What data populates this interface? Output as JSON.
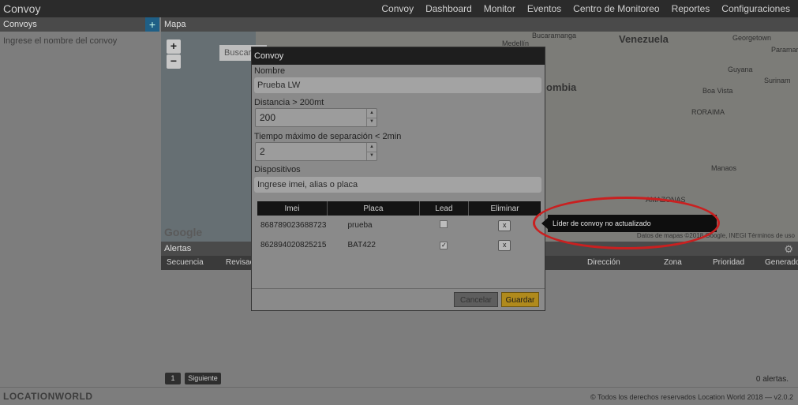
{
  "app": {
    "title": "Convoy"
  },
  "nav": [
    "Convoy",
    "Dashboard",
    "Monitor",
    "Eventos",
    "Centro de Monitoreo",
    "Reportes",
    "Configuraciones"
  ],
  "left": {
    "header": "Convoys",
    "add_icon": "+",
    "search_placeholder": "Ingrese el nombre del convoy"
  },
  "map": {
    "header": "Mapa",
    "zoom_in": "+",
    "zoom_out": "−",
    "search_placeholder": "Buscar",
    "labels": {
      "venezuela": "Venezuela",
      "colombia": "ombia",
      "bucaramanga": "Bucaramanga",
      "medellin": "Medellín",
      "georgetown": "Georgetown",
      "paramaribo": "Paramar",
      "guyana": "Guyana",
      "surinam": "Surinam",
      "boa_vista": "Boa Vista",
      "roraima": "RORAIMA",
      "manaos": "Manaos",
      "amazonas": "AMAZONAS"
    },
    "google": "Google",
    "attribution": "Datos de mapas ©2018 Google, INEGI   Términos de uso"
  },
  "alerts": {
    "header": "Alertas",
    "gear_icon": "gear-icon",
    "columns": [
      "Secuencia",
      "Revisado",
      "Dirección",
      "Zona",
      "Prioridad",
      "Generado"
    ],
    "pager": {
      "page": "1",
      "next": "Siguiente"
    },
    "count": "0 alertas."
  },
  "footer": {
    "logo": "LOCATIONWORLD",
    "copyright": "© Todos los derechos reservados Location World 2018 — v2.0.2"
  },
  "modal": {
    "title": "Convoy",
    "nombre_label": "Nombre",
    "nombre_value": "Prueba LW",
    "distancia_label": "Distancia > 200mt",
    "distancia_value": "200",
    "tiempo_label": "Tiempo máximo de separación < 2min",
    "tiempo_value": "2",
    "dispositivos_label": "Dispositivos",
    "dispositivos_placeholder": "Ingrese imei, alias o placa",
    "table": {
      "headers": [
        "Imei",
        "Placa",
        "Lead",
        "Eliminar"
      ],
      "rows": [
        {
          "imei": "868789023688723",
          "placa": "prueba",
          "lead": false,
          "delete": "x"
        },
        {
          "imei": "862894020825215",
          "placa": "BAT422",
          "lead": true,
          "delete": "x"
        }
      ]
    },
    "cancel": "Cancelar",
    "save": "Guardar"
  },
  "tooltip": {
    "text": "Líder de convoy no actualizado"
  },
  "colors": {
    "annotation": "#c92020",
    "save_button": "#b08a1c",
    "add_button": "#1f5f86"
  }
}
